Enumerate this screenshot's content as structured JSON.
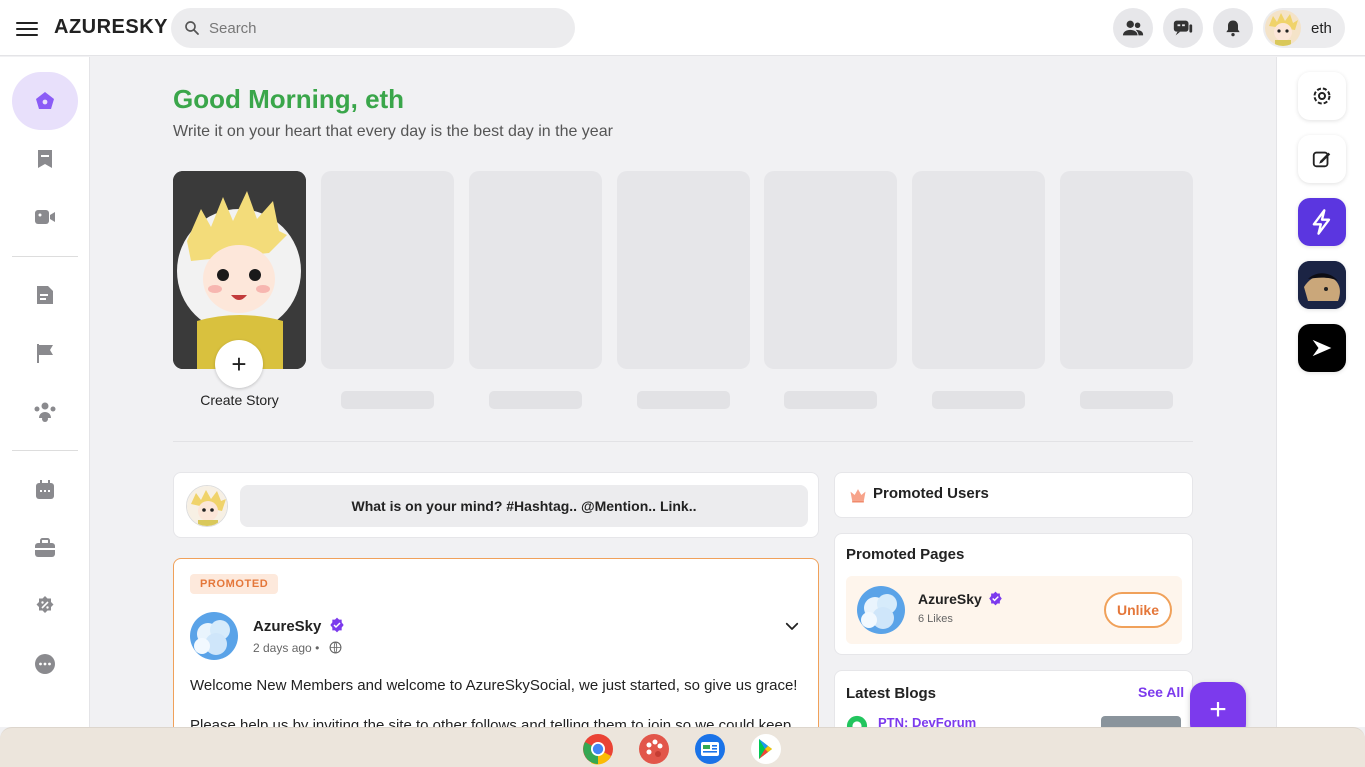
{
  "header": {
    "brand": "AZURESKY",
    "search_placeholder": "Search",
    "icons": [
      "people-icon",
      "chat-icon",
      "bell-icon"
    ],
    "user_name": "eth"
  },
  "sidebar": {
    "items": [
      {
        "icon": "home-icon",
        "active": true
      },
      {
        "icon": "bookmark-icon"
      },
      {
        "icon": "video-icon"
      },
      {
        "icon": "document-icon"
      },
      {
        "icon": "flag-icon"
      },
      {
        "icon": "groups-icon"
      },
      {
        "icon": "calendar-icon"
      },
      {
        "icon": "briefcase-icon"
      },
      {
        "icon": "discount-icon"
      },
      {
        "icon": "more-icon"
      }
    ]
  },
  "main": {
    "greeting": "Good Morning, eth",
    "quote": "Write it on your heart that every day is the best day in the year",
    "create_story_label": "Create Story",
    "composer_prompt": "What is on your mind? #Hashtag.. @Mention.. Link.."
  },
  "post": {
    "badge": "PROMOTED",
    "author": "AzureSky",
    "time": "2 days ago",
    "separator": "•",
    "text": "Welcome New Members and welcome to AzureSkySocial, we just started, so give us grace!",
    "text_cutoff": "Please help us by inviting the site to other follows and telling them to join so we could keep..."
  },
  "promoted_users": {
    "title": "Promoted Users"
  },
  "promoted_pages": {
    "title": "Promoted Pages",
    "page_name": "AzureSky",
    "likes": "6 Likes",
    "unlike_label": "Unlike"
  },
  "latest_blogs": {
    "title": "Latest Blogs",
    "see_all": "See All",
    "first_blog": "PTN: DevForum"
  },
  "fab_label": "+",
  "colors": {
    "accent": "#7c3aed",
    "greeting": "#3aa64a",
    "promo": "#e4773a"
  },
  "taskbar": {
    "apps": [
      "chrome-icon",
      "palette-icon",
      "news-icon",
      "play-store-icon"
    ]
  }
}
